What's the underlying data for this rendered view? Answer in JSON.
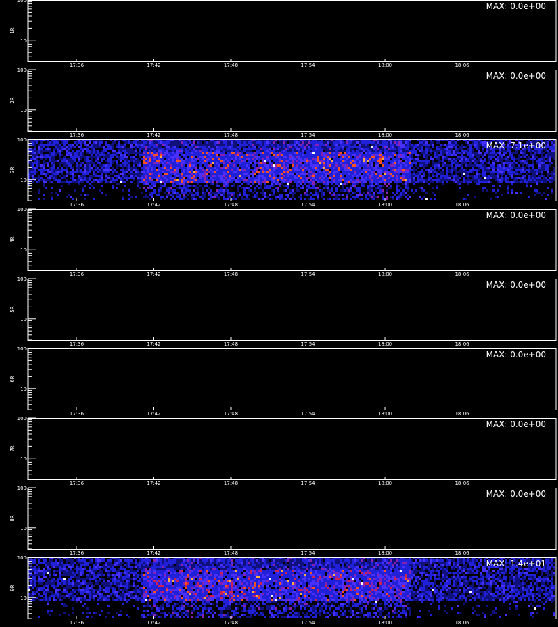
{
  "chart_data": {
    "type": "heatmap",
    "time_ticks": [
      "17:36",
      "17:42",
      "17:48",
      "17:54",
      "18:00",
      "18:06"
    ],
    "y_axis": {
      "scale": "log",
      "range": [
        3,
        100
      ],
      "tick_labels": [
        "10",
        "100"
      ]
    },
    "panels": [
      {
        "ylabel": "1R",
        "max_label": "MAX: 0.0e+00",
        "max_value": 0.0,
        "active": false
      },
      {
        "ylabel": "2R",
        "max_label": "MAX: 0.0e+00",
        "max_value": 0.0,
        "active": false
      },
      {
        "ylabel": "3R",
        "max_label": "MAX: 7.1e+00",
        "max_value": 7.1,
        "active": true
      },
      {
        "ylabel": "4R",
        "max_label": "MAX: 0.0e+00",
        "max_value": 0.0,
        "active": false
      },
      {
        "ylabel": "5R",
        "max_label": "MAX: 0.0e+00",
        "max_value": 0.0,
        "active": false
      },
      {
        "ylabel": "6R",
        "max_label": "MAX: 0.0e+00",
        "max_value": 0.0,
        "active": false
      },
      {
        "ylabel": "7R",
        "max_label": "MAX: 0.0e+00",
        "max_value": 0.0,
        "active": false
      },
      {
        "ylabel": "8R",
        "max_label": "MAX: 0.0e+00",
        "max_value": 0.0,
        "active": false
      },
      {
        "ylabel": "9R",
        "max_label": "MAX: 1.4e+01",
        "max_value": 14.0,
        "active": true
      }
    ],
    "active_interval": [
      "17:41",
      "18:02"
    ],
    "colormap": [
      "#000000",
      "#10107a",
      "#2020d8",
      "#4a30ff",
      "#8a20b0",
      "#d02050",
      "#ff5020",
      "#ffb040",
      "#ffffff"
    ],
    "grid": false,
    "legend": "none"
  }
}
